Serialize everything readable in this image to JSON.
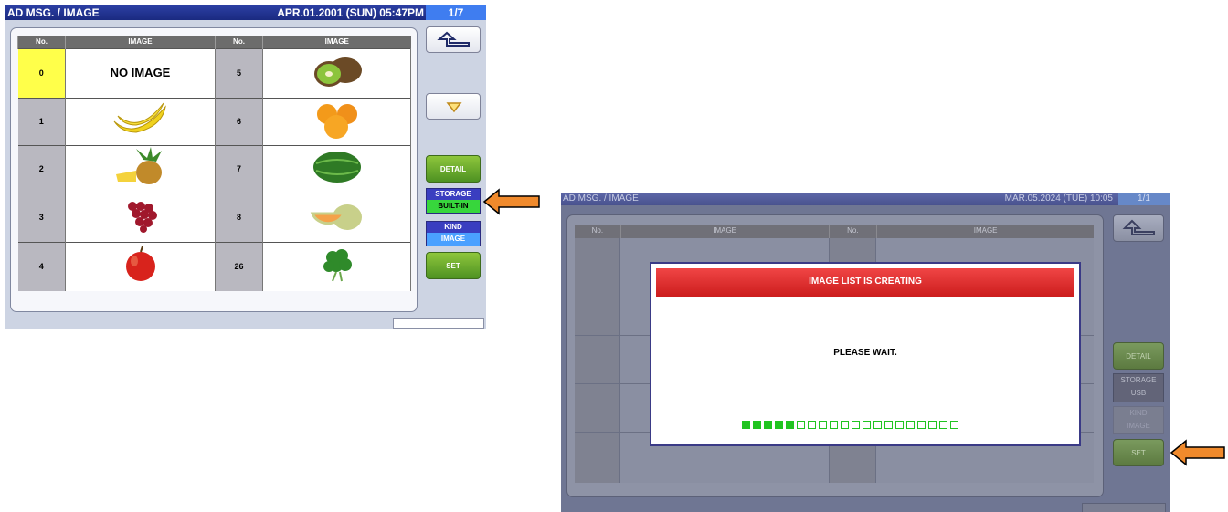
{
  "left": {
    "title": "AD MSG. / IMAGE",
    "datetime": "APR.01.2001 (SUN)  05:47PM",
    "page": "1/7",
    "headers": {
      "no": "No.",
      "image": "IMAGE"
    },
    "rows": [
      {
        "no_a": "0",
        "img_a": "NO IMAGE",
        "no_b": "5",
        "img_b": "kiwi-image"
      },
      {
        "no_a": "1",
        "img_a": "banana-image",
        "no_b": "6",
        "img_b": "orange-image"
      },
      {
        "no_a": "2",
        "img_a": "pineapple-image",
        "no_b": "7",
        "img_b": "watermelon-image"
      },
      {
        "no_a": "3",
        "img_a": "grape-image",
        "no_b": "8",
        "img_b": "melon-image"
      },
      {
        "no_a": "4",
        "img_a": "apple-image",
        "no_b": "26",
        "img_b": "parsley-image"
      }
    ],
    "detail": "DETAIL",
    "storage_label": "STORAGE",
    "storage_value": "BUILT-IN",
    "kind_label": "KIND",
    "kind_value": "IMAGE",
    "set": "SET"
  },
  "right": {
    "title": "AD MSG. / IMAGE",
    "datetime": "MAR.05.2024 (TUE)  10:05",
    "page": "1/1",
    "headers": {
      "no": "No.",
      "image": "IMAGE"
    },
    "dialog_title": "IMAGE LIST IS CREATING",
    "dialog_message": "PLEASE WAIT.",
    "progress_filled": 5,
    "progress_total": 20,
    "detail": "DETAIL",
    "storage_label": "STORAGE",
    "storage_value": "USB",
    "kind_label": "KIND",
    "kind_value": "IMAGE",
    "set": "SET"
  },
  "colors": {
    "arrow": "#f08a2c",
    "progress": "#21c421",
    "selected_cell": "#ffff4a"
  }
}
